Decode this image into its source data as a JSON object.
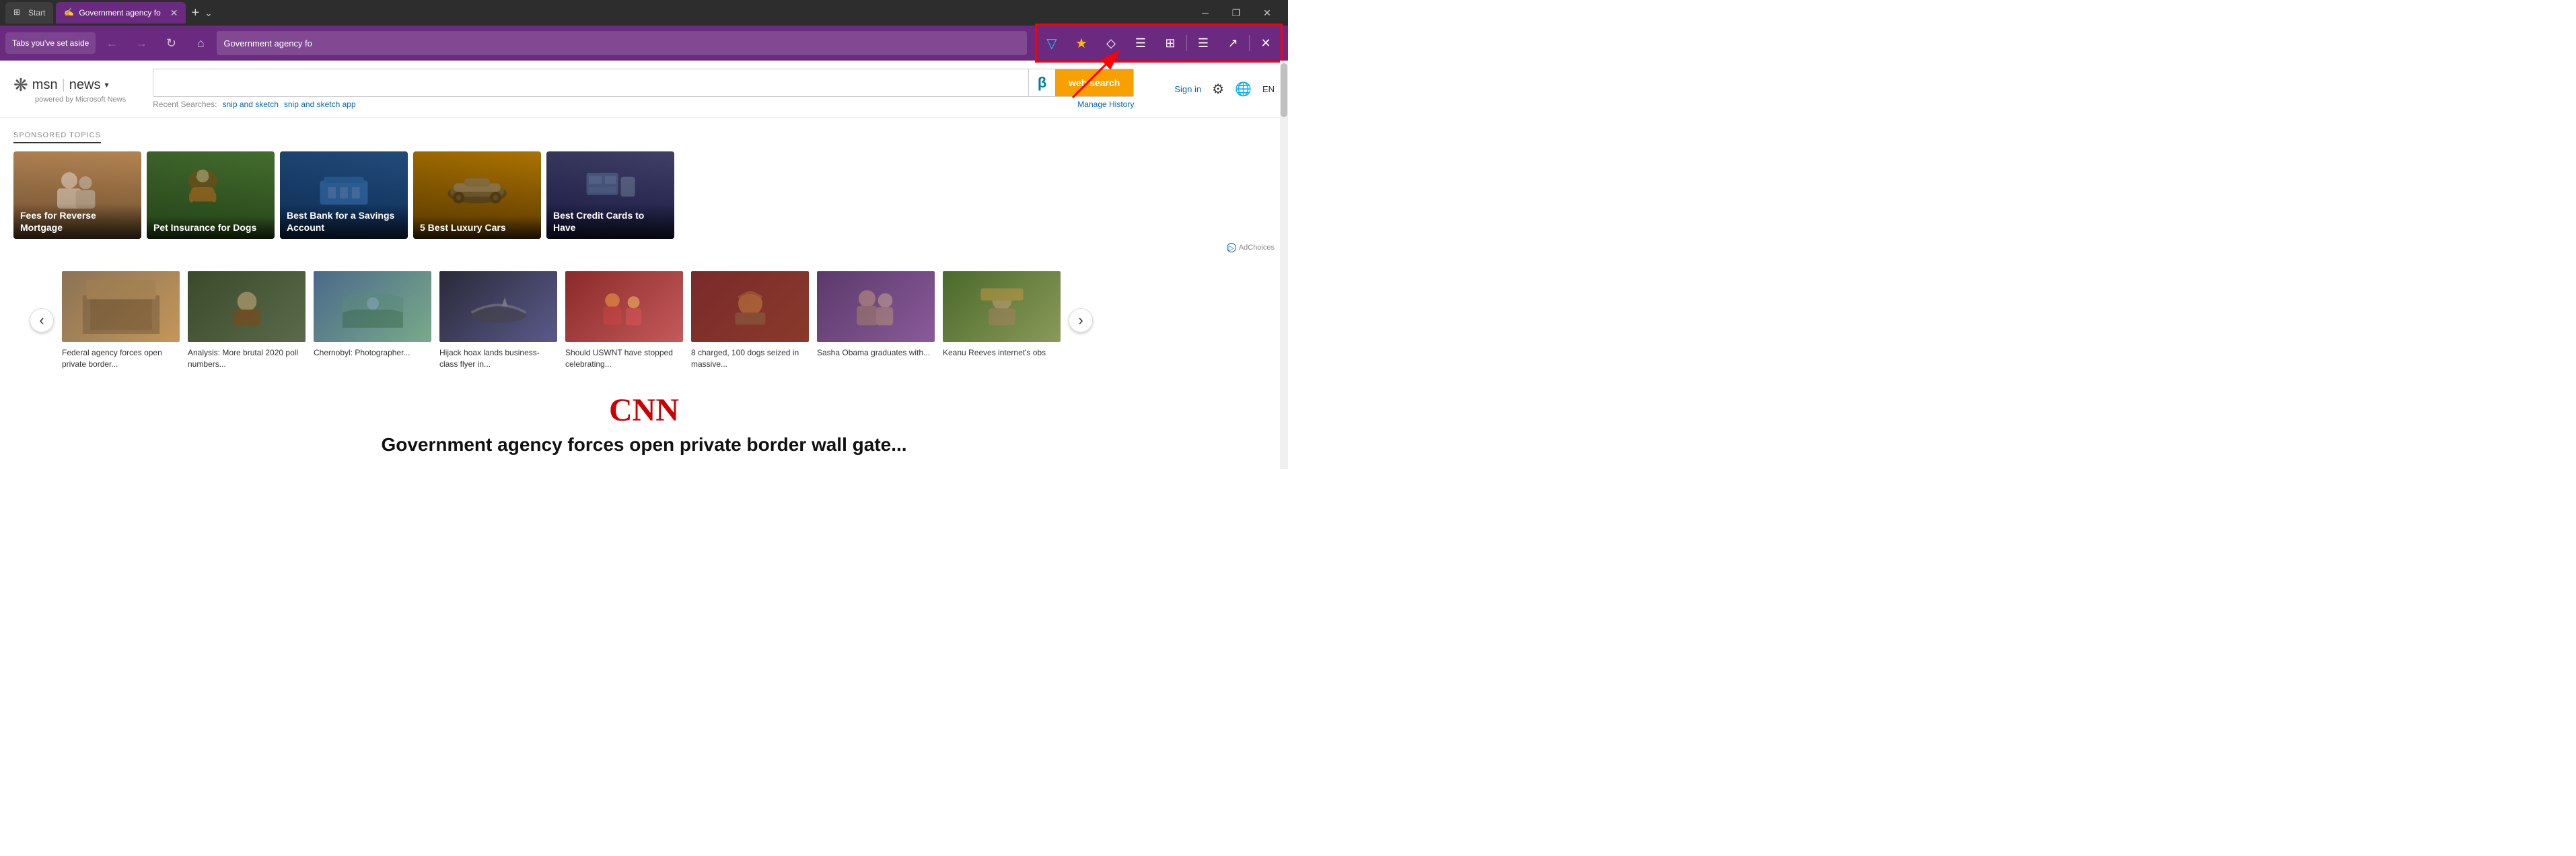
{
  "browser": {
    "tabs": [
      {
        "id": "start",
        "label": "Start",
        "icon": "⊞",
        "active": false
      },
      {
        "id": "govt",
        "label": "Government agency fo",
        "icon": "✍",
        "active": true
      }
    ],
    "tab_add": "+",
    "tab_dropdown": "⌄",
    "win_minimize": "─",
    "win_restore": "❐",
    "win_close": "✕"
  },
  "navbar": {
    "back": "←",
    "forward": "→",
    "refresh": "↻",
    "home": "⌂",
    "address": "Government agency fo",
    "tabs_aside_label": "Tabs you've set aside",
    "toolbar_icons": [
      {
        "name": "reading-list-icon",
        "symbol": "▽",
        "color": "#00d4ff",
        "label": "Reading list"
      },
      {
        "name": "favorites-icon",
        "symbol": "★",
        "color": "#ffb900",
        "label": "Favorites"
      },
      {
        "name": "notes-icon",
        "symbol": "◇",
        "label": "Notes"
      },
      {
        "name": "reading-view-icon",
        "symbol": "☰",
        "label": "Reading view"
      },
      {
        "name": "immersive-reader-icon",
        "symbol": "⊞",
        "label": "Immersive reader"
      },
      {
        "name": "hub-icon",
        "symbol": "☰",
        "label": "Hub"
      },
      {
        "name": "share-icon",
        "symbol": "↗",
        "label": "Share"
      },
      {
        "name": "close-aside-icon",
        "symbol": "✕",
        "label": "Close"
      }
    ]
  },
  "msn": {
    "logo_symbol": "❋",
    "msn_text": "msn",
    "news_text": "news",
    "news_arrow": "▾",
    "powered_by": "powered by Microsoft News",
    "search_placeholder": "",
    "search_btn": "web search",
    "recent_label": "Recent Searches:",
    "recent_items": [
      "snip and sketch",
      "snip and sketch app"
    ],
    "manage_history": "Manage History",
    "sign_in": "Sign in",
    "lang": "EN"
  },
  "sponsored": {
    "label": "SPONSORED TOPICS",
    "topics": [
      {
        "id": 1,
        "title": "Fees for Reverse Mortgage",
        "bg": "#8b7355"
      },
      {
        "id": 2,
        "title": "Pet Insurance for Dogs",
        "bg": "#4a7a3a"
      },
      {
        "id": 3,
        "title": "Best Bank for a Savings Account",
        "bg": "#2d5a8a"
      },
      {
        "id": 4,
        "title": "5 Best Luxury Cars",
        "bg": "#8a6a00"
      },
      {
        "id": 5,
        "title": "Best Credit Cards to Have",
        "bg": "#3a3a5a"
      }
    ],
    "ad_choices": "AdChoices"
  },
  "news": {
    "prev_btn": "‹",
    "next_btn": "›",
    "articles": [
      {
        "id": 1,
        "title": "Federal agency forces open private border...",
        "bg": "nc1"
      },
      {
        "id": 2,
        "title": "Analysis: More brutal 2020 poll numbers...",
        "bg": "nc2"
      },
      {
        "id": 3,
        "title": "Chernobyl: Photographer...",
        "bg": "nc3"
      },
      {
        "id": 4,
        "title": "Hijack hoax lands business-class flyer in...",
        "bg": "nc4"
      },
      {
        "id": 5,
        "title": "Should USWNT have stopped celebrating...",
        "bg": "nc5"
      },
      {
        "id": 6,
        "title": "8 charged, 100 dogs seized in massive...",
        "bg": "nc6"
      },
      {
        "id": 7,
        "title": "Sasha Obama graduates with...",
        "bg": "nc7"
      },
      {
        "id": 8,
        "title": "Keanu Reeves internet's obs",
        "bg": "nc8"
      }
    ]
  },
  "cnn": {
    "logo": "CNN",
    "headline": "Government agency forces open private border wall gate..."
  },
  "annotation": {
    "arrow_label": "toolbar highlight"
  }
}
